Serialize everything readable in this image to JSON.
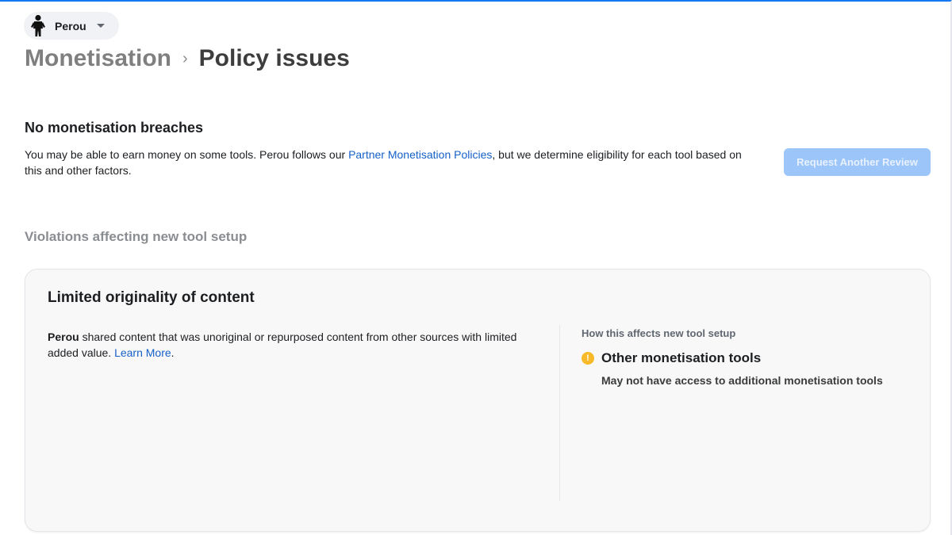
{
  "profile": {
    "name": "Perou",
    "avatar_icon": "person-silhouette-icon",
    "dropdown_icon": "caret-down-icon"
  },
  "breadcrumb": {
    "parent": "Monetisation",
    "separator": "›",
    "current": "Policy issues"
  },
  "status": {
    "title": "No monetisation breaches",
    "desc_prefix": "You may be able to earn money on some tools. Perou follows our ",
    "policy_link": "Partner Monetisation Policies",
    "desc_suffix": ", but we determine eligibility for each tool based on this and other factors.",
    "review_button": "Request Another Review"
  },
  "violations": {
    "heading": "Violations affecting new tool setup",
    "items": [
      {
        "title": "Limited originality of content",
        "subject": "Perou",
        "desc": " shared content that was unoriginal or repurposed content from other sources with limited added value. ",
        "learn_more": "Learn More",
        "desc_end": ".",
        "affects_heading": "How this affects new tool setup",
        "effects": [
          {
            "icon": "warning-icon",
            "icon_glyph": "!",
            "title": "Other monetisation tools",
            "desc": "May not have access to additional monetisation tools"
          }
        ]
      }
    ]
  },
  "colors": {
    "accent": "#1877f2",
    "link": "#1660c9",
    "button_disabled": "#9cc5fa",
    "warning": "#f7b928"
  }
}
